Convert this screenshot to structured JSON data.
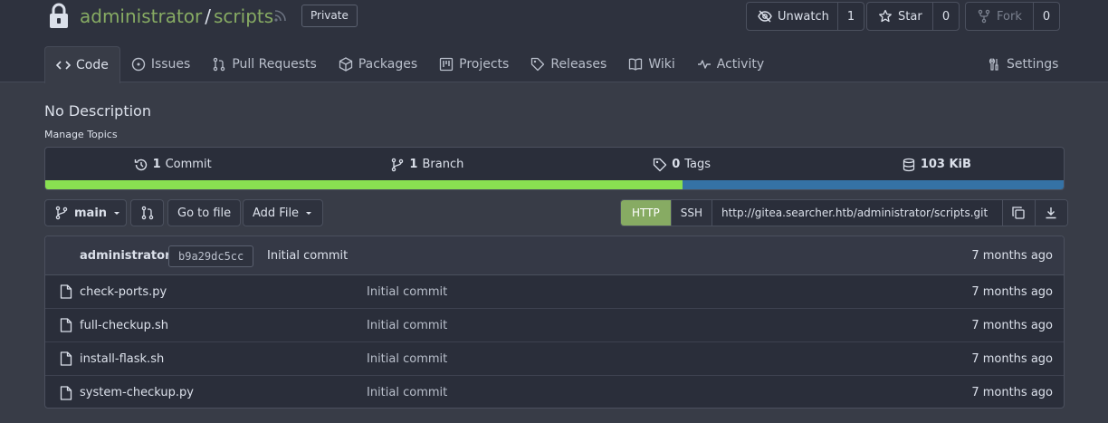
{
  "repo": {
    "owner": "administrator",
    "separator": "/",
    "name": "scripts",
    "visibility": "Private"
  },
  "actions": {
    "watch_label": "Unwatch",
    "watch_count": "1",
    "star_label": "Star",
    "star_count": "0",
    "fork_label": "Fork",
    "fork_count": "0"
  },
  "tabs": [
    {
      "label": "Code",
      "icon": "code-icon"
    },
    {
      "label": "Issues",
      "icon": "issue-icon"
    },
    {
      "label": "Pull Requests",
      "icon": "pull-request-icon"
    },
    {
      "label": "Packages",
      "icon": "package-icon"
    },
    {
      "label": "Projects",
      "icon": "project-icon"
    },
    {
      "label": "Releases",
      "icon": "tag-icon"
    },
    {
      "label": "Wiki",
      "icon": "book-icon"
    },
    {
      "label": "Activity",
      "icon": "pulse-icon"
    }
  ],
  "settings_label": "Settings",
  "description": "No Description",
  "manage_topics": "Manage Topics",
  "stats": {
    "commits_num": "1",
    "commits_label": "Commit",
    "branches_num": "1",
    "branches_label": "Branch",
    "tags_num": "0",
    "tags_label": "Tags",
    "size": "103 KiB"
  },
  "languages": [
    {
      "share": 0.626,
      "color": "#89e051"
    },
    {
      "share": 0.374,
      "color": "#3572a5"
    }
  ],
  "toolbar": {
    "branch": "main",
    "go_to_file": "Go to file",
    "add_file": "Add File"
  },
  "clone": {
    "http": "HTTP",
    "ssh": "SSH",
    "url": "http://gitea.searcher.htb/administrator/scripts.git"
  },
  "latest_commit": {
    "author": "administrator",
    "sha": "b9a29dc5cc",
    "message": "Initial commit",
    "age": "7 months ago"
  },
  "files": [
    {
      "name": "check-ports.py",
      "message": "Initial commit",
      "age": "7 months ago"
    },
    {
      "name": "full-checkup.sh",
      "message": "Initial commit",
      "age": "7 months ago"
    },
    {
      "name": "install-flask.sh",
      "message": "Initial commit",
      "age": "7 months ago"
    },
    {
      "name": "system-checkup.py",
      "message": "Initial commit",
      "age": "7 months ago"
    }
  ]
}
